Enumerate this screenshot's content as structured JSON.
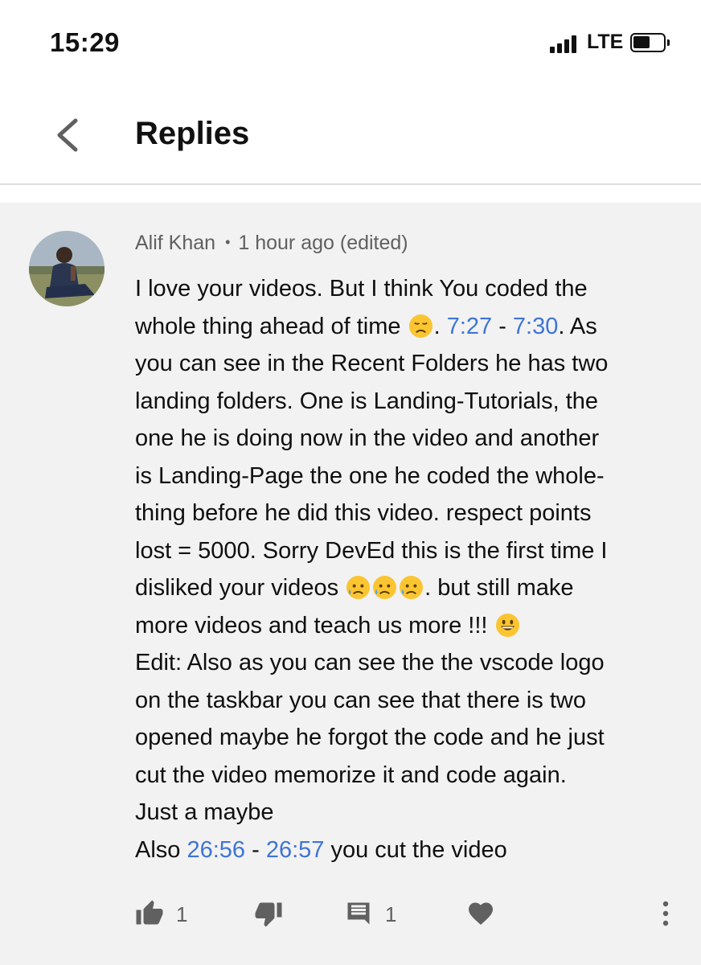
{
  "status_bar": {
    "time": "15:29",
    "network": "LTE"
  },
  "header": {
    "title": "Replies"
  },
  "comment": {
    "author": "Alif Khan",
    "separator": "•",
    "age": "1 hour ago (edited)",
    "body": {
      "l1": "I love your videos. But I think You coded the",
      "l2a": "whole thing ahead of time",
      "l2b": ". ",
      "ts1": "7:27",
      "dash1": " - ",
      "ts2": "7:30",
      "l2c": ". As",
      "l3": "you can see in the Recent Folders he has two",
      "l4": "landing folders. One is Landing-Tutorials, the",
      "l5": "one he is doing now in the video and another",
      "l6": "is Landing-Page the one he coded the whole-",
      "l7": "thing before he did this video. respect points",
      "l8": "lost = 5000. Sorry DevEd this is the first time I",
      "l9a": "disliked your videos",
      "l9b": ". but still make",
      "l10": "more videos and teach us more !!!",
      "l11": "Edit: Also as you can see the the vscode logo",
      "l12": "on the taskbar you can see that there is two",
      "l13": "opened maybe he forgot the code and he just",
      "l14": "cut the video memorize it and code again.",
      "l15": "Just a maybe",
      "l16a": "Also ",
      "ts3": "26:56",
      "dash2": " - ",
      "ts4": "26:57",
      "l16b": " you cut the video"
    },
    "like_count": "1",
    "reply_count": "1"
  },
  "colors": {
    "timestamp_link": "#3f74d6",
    "meta_text": "#606060",
    "background": "#f2f2f2"
  },
  "icons": [
    "back-chevron-icon",
    "thumbs-up-icon",
    "thumbs-down-icon",
    "comment-icon",
    "heart-icon",
    "more-vertical-icon"
  ]
}
